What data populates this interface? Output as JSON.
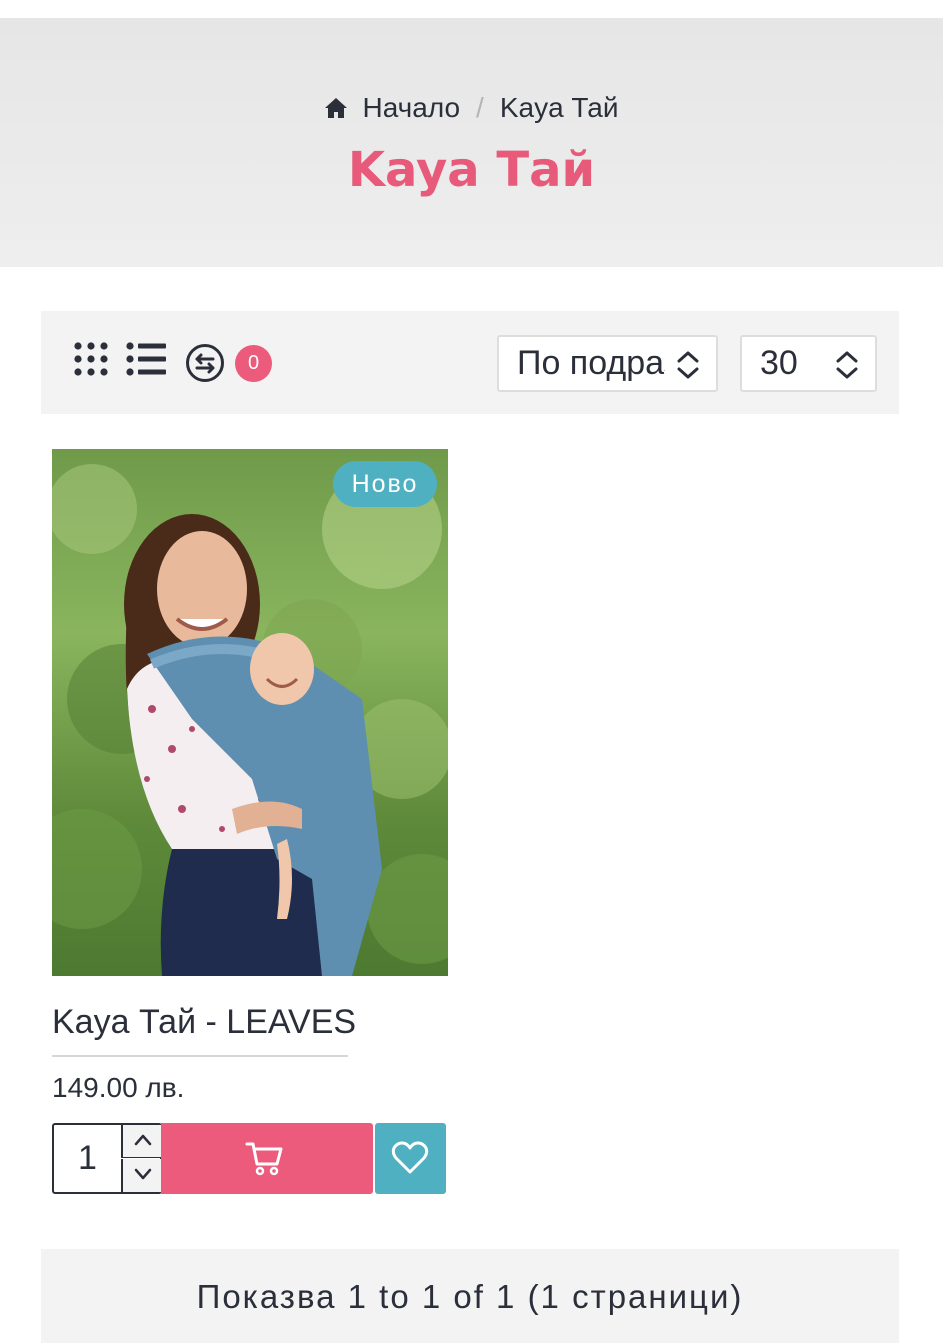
{
  "breadcrumb": {
    "home": "Начало",
    "current": "Kaya Тай"
  },
  "page": {
    "title": "Kaya Тай"
  },
  "toolbar": {
    "compare_count": "0",
    "sort_value": "По подразбиране",
    "limit_value": "30"
  },
  "product": {
    "badge": "Ново",
    "name": "Kaya Тай - LEAVES",
    "price": "149.00 лв.",
    "quantity": "1"
  },
  "pagination": {
    "text": "Показва 1 to 1 of 1 (1 страници)"
  },
  "colors": {
    "accent_pink": "#ec5b7c",
    "accent_teal": "#4fb0c1",
    "title_pink": "#e85a7a"
  }
}
